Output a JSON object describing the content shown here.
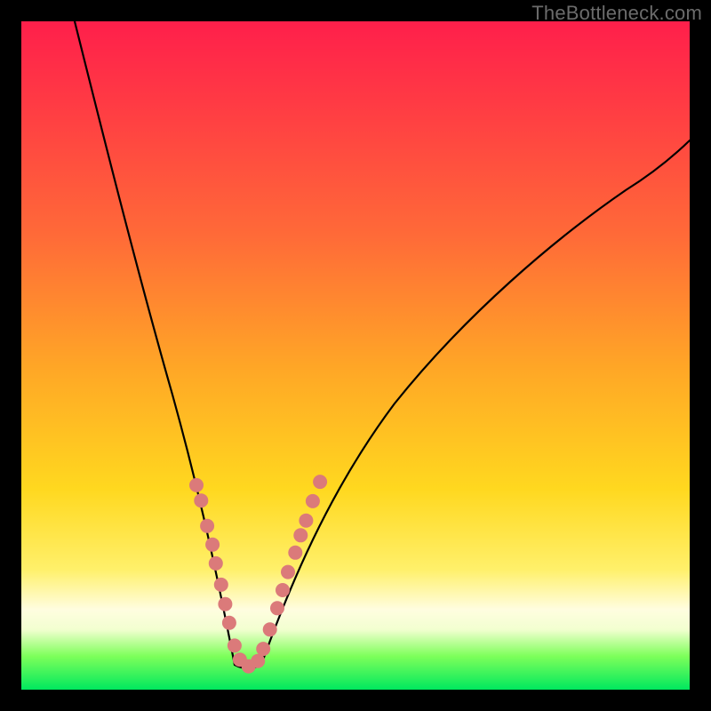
{
  "watermark": "TheBottleneck.com",
  "colors": {
    "frame": "#000000",
    "dot": "#db7a7a",
    "curve_stroke": "#000000",
    "gradient_stops": [
      "#ff1f4b",
      "#ff3a44",
      "#ff6a38",
      "#ffa726",
      "#ffd81f",
      "#fff06a",
      "#fffde0",
      "#f2ffd0",
      "#7dff5a",
      "#00e85e"
    ]
  },
  "chart_data": {
    "type": "line",
    "title": "",
    "xlabel": "",
    "ylabel": "",
    "xlim": [
      0,
      100
    ],
    "ylim": [
      0,
      100
    ],
    "note": "Axes are unitless percentages of the plot area; x increases rightward, y increases upward.",
    "series": [
      {
        "name": "left-branch",
        "x": [
          8.0,
          10.6,
          13.3,
          16.0,
          18.6,
          21.3,
          23.9,
          26.6,
          29.3,
          31.9
        ],
        "y": [
          100.0,
          89.1,
          78.5,
          67.9,
          57.4,
          47.0,
          37.0,
          27.7,
          16.8,
          3.7
        ]
      },
      {
        "name": "valley-floor",
        "x": [
          31.9,
          33.2,
          34.6,
          35.9
        ],
        "y": [
          3.7,
          2.9,
          2.9,
          3.7
        ]
      },
      {
        "name": "right-branch",
        "x": [
          35.9,
          39.3,
          42.6,
          47.9,
          53.2,
          58.5,
          63.8,
          69.1,
          74.5,
          79.8,
          85.1,
          90.4,
          95.7,
          100.0
        ],
        "y": [
          3.7,
          13.4,
          23.0,
          34.2,
          43.4,
          51.3,
          57.7,
          63.3,
          67.9,
          71.7,
          75.0,
          77.8,
          80.3,
          82.2
        ]
      }
    ],
    "points": [
      {
        "name": "left-cluster",
        "x_pct": 26.2,
        "y_pct": 30.6,
        "r_pct": 1.06
      },
      {
        "name": "left-cluster",
        "x_pct": 26.9,
        "y_pct": 28.3,
        "r_pct": 1.06
      },
      {
        "name": "left-cluster",
        "x_pct": 27.8,
        "y_pct": 24.5,
        "r_pct": 1.06
      },
      {
        "name": "left-cluster",
        "x_pct": 28.6,
        "y_pct": 21.7,
        "r_pct": 1.06
      },
      {
        "name": "left-cluster",
        "x_pct": 29.1,
        "y_pct": 18.9,
        "r_pct": 1.06
      },
      {
        "name": "left-cluster",
        "x_pct": 29.9,
        "y_pct": 15.7,
        "r_pct": 1.06
      },
      {
        "name": "left-cluster",
        "x_pct": 30.5,
        "y_pct": 12.8,
        "r_pct": 1.06
      },
      {
        "name": "left-cluster",
        "x_pct": 31.1,
        "y_pct": 10.0,
        "r_pct": 1.06
      },
      {
        "name": "valley",
        "x_pct": 31.9,
        "y_pct": 6.6,
        "r_pct": 1.06
      },
      {
        "name": "valley",
        "x_pct": 32.7,
        "y_pct": 4.5,
        "r_pct": 1.06
      },
      {
        "name": "valley",
        "x_pct": 34.0,
        "y_pct": 3.5,
        "r_pct": 1.06
      },
      {
        "name": "valley",
        "x_pct": 35.4,
        "y_pct": 4.3,
        "r_pct": 1.06
      },
      {
        "name": "valley",
        "x_pct": 36.2,
        "y_pct": 6.1,
        "r_pct": 1.06
      },
      {
        "name": "right-cluster",
        "x_pct": 37.2,
        "y_pct": 9.0,
        "r_pct": 1.06
      },
      {
        "name": "right-cluster",
        "x_pct": 38.3,
        "y_pct": 12.2,
        "r_pct": 1.06
      },
      {
        "name": "right-cluster",
        "x_pct": 39.1,
        "y_pct": 14.9,
        "r_pct": 1.06
      },
      {
        "name": "right-cluster",
        "x_pct": 39.9,
        "y_pct": 17.6,
        "r_pct": 1.06
      },
      {
        "name": "right-cluster",
        "x_pct": 41.0,
        "y_pct": 20.5,
        "r_pct": 1.06
      },
      {
        "name": "right-cluster",
        "x_pct": 41.8,
        "y_pct": 23.1,
        "r_pct": 1.06
      },
      {
        "name": "right-cluster",
        "x_pct": 42.6,
        "y_pct": 25.3,
        "r_pct": 1.06
      },
      {
        "name": "right-cluster",
        "x_pct": 43.6,
        "y_pct": 28.2,
        "r_pct": 1.06
      },
      {
        "name": "right-cluster",
        "x_pct": 44.7,
        "y_pct": 31.1,
        "r_pct": 1.06
      }
    ]
  }
}
